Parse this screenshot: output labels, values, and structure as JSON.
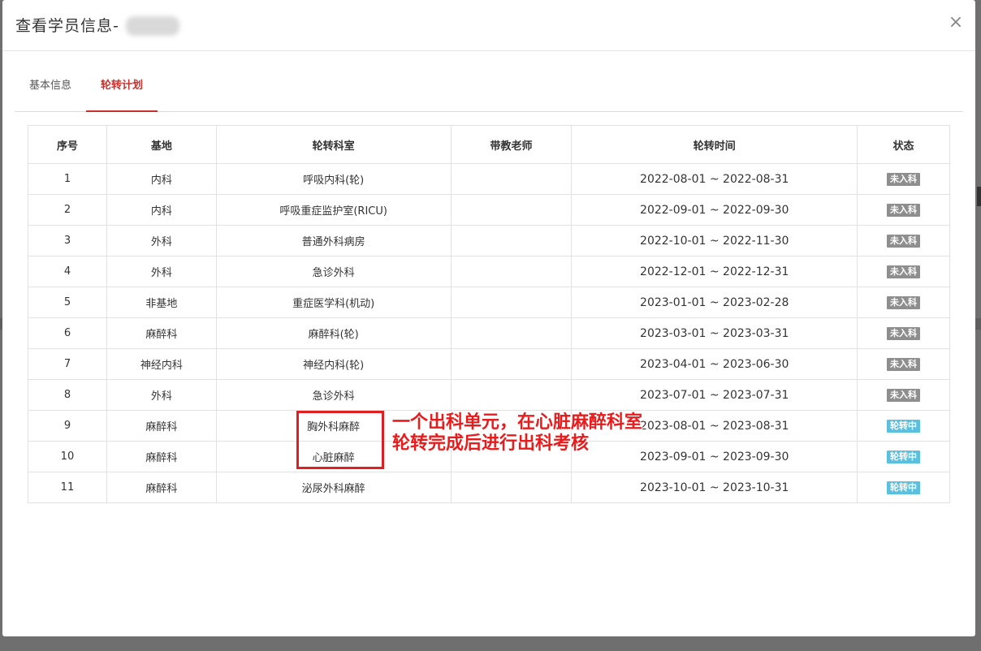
{
  "modal": {
    "title": "查看学员信息-",
    "close_label": "×"
  },
  "tabs": [
    {
      "label": "基本信息",
      "active": false
    },
    {
      "label": "轮转计划",
      "active": true
    }
  ],
  "table": {
    "headers": [
      "序号",
      "基地",
      "轮转科室",
      "带教老师",
      "轮转时间",
      "状态"
    ],
    "rows": [
      {
        "no": "1",
        "base": "内科",
        "dept": "呼吸内科(轮)",
        "teacher": "",
        "time": "2022-08-01 ~ 2022-08-31",
        "status": "未入科"
      },
      {
        "no": "2",
        "base": "内科",
        "dept": "呼吸重症监护室(RICU)",
        "teacher": "",
        "time": "2022-09-01 ~ 2022-09-30",
        "status": "未入科"
      },
      {
        "no": "3",
        "base": "外科",
        "dept": "普通外科病房",
        "teacher": "",
        "time": "2022-10-01 ~ 2022-11-30",
        "status": "未入科"
      },
      {
        "no": "4",
        "base": "外科",
        "dept": "急诊外科",
        "teacher": "",
        "time": "2022-12-01 ~ 2022-12-31",
        "status": "未入科"
      },
      {
        "no": "5",
        "base": "非基地",
        "dept": "重症医学科(机动)",
        "teacher": "",
        "time": "2023-01-01 ~ 2023-02-28",
        "status": "未入科"
      },
      {
        "no": "6",
        "base": "麻醉科",
        "dept": "麻醉科(轮)",
        "teacher": "",
        "time": "2023-03-01 ~ 2023-03-31",
        "status": "未入科"
      },
      {
        "no": "7",
        "base": "神经内科",
        "dept": "神经内科(轮)",
        "teacher": "",
        "time": "2023-04-01 ~ 2023-06-30",
        "status": "未入科"
      },
      {
        "no": "8",
        "base": "外科",
        "dept": "急诊外科",
        "teacher": "",
        "time": "2023-07-01 ~ 2023-07-31",
        "status": "未入科"
      },
      {
        "no": "9",
        "base": "麻醉科",
        "dept": "胸外科麻醉",
        "teacher": "",
        "time": "2023-08-01 ~ 2023-08-31",
        "status": "轮转中"
      },
      {
        "no": "10",
        "base": "麻醉科",
        "dept": "心脏麻醉",
        "teacher": "",
        "time": "2023-09-01 ~ 2023-09-30",
        "status": "轮转中"
      },
      {
        "no": "11",
        "base": "麻醉科",
        "dept": "泌尿外科麻醉",
        "teacher": "",
        "time": "2023-10-01 ~ 2023-10-31",
        "status": "轮转中"
      }
    ]
  },
  "annotation": {
    "line1": "一个出科单元，在心脏麻醉科室",
    "line2": "轮转完成后进行出科考核"
  },
  "colors": {
    "accent": "#c9302c",
    "badge_not_entered": "#8e8e8e",
    "badge_rotating": "#5bc0de",
    "annotation": "#e81c1c"
  }
}
